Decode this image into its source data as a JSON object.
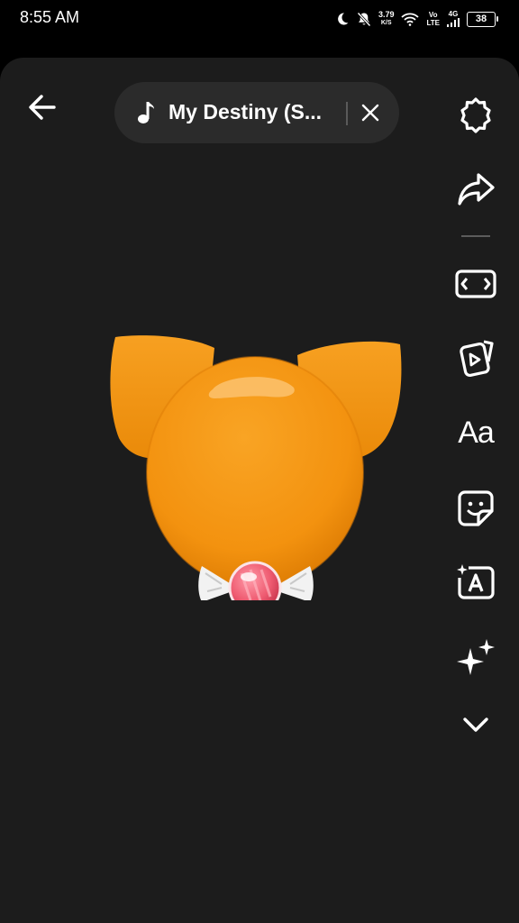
{
  "status_bar": {
    "time": "8:55 AM",
    "net_speed_value": "3.79",
    "net_speed_unit": "K/S",
    "volte_top": "Vo",
    "volte_bottom": "LTE",
    "network_type": "4G",
    "battery_level": "38"
  },
  "top_bar": {
    "back_icon": "arrow-left-icon",
    "music_title": "My Destiny (S...",
    "music_icon": "music-note-icon",
    "remove_icon": "close-icon"
  },
  "tools": [
    {
      "name": "settings",
      "icon": "gear-icon"
    },
    {
      "name": "share",
      "icon": "share-arrow-icon"
    },
    {
      "name": "aspect-ratio",
      "icon": "aspect-ratio-icon"
    },
    {
      "name": "video",
      "icon": "play-cards-icon"
    },
    {
      "name": "text",
      "label": "Aa"
    },
    {
      "name": "sticker",
      "icon": "sticker-icon"
    },
    {
      "name": "auto-captions",
      "icon": "caption-a-icon"
    },
    {
      "name": "effects",
      "icon": "sparkle-icon"
    },
    {
      "name": "more",
      "icon": "chevron-down-icon"
    }
  ],
  "colors": {
    "background": "#1c1c1c",
    "pill": "#2b2b2b",
    "sticker_orange": "#f59a18",
    "candy_pink": "#e8445d"
  }
}
